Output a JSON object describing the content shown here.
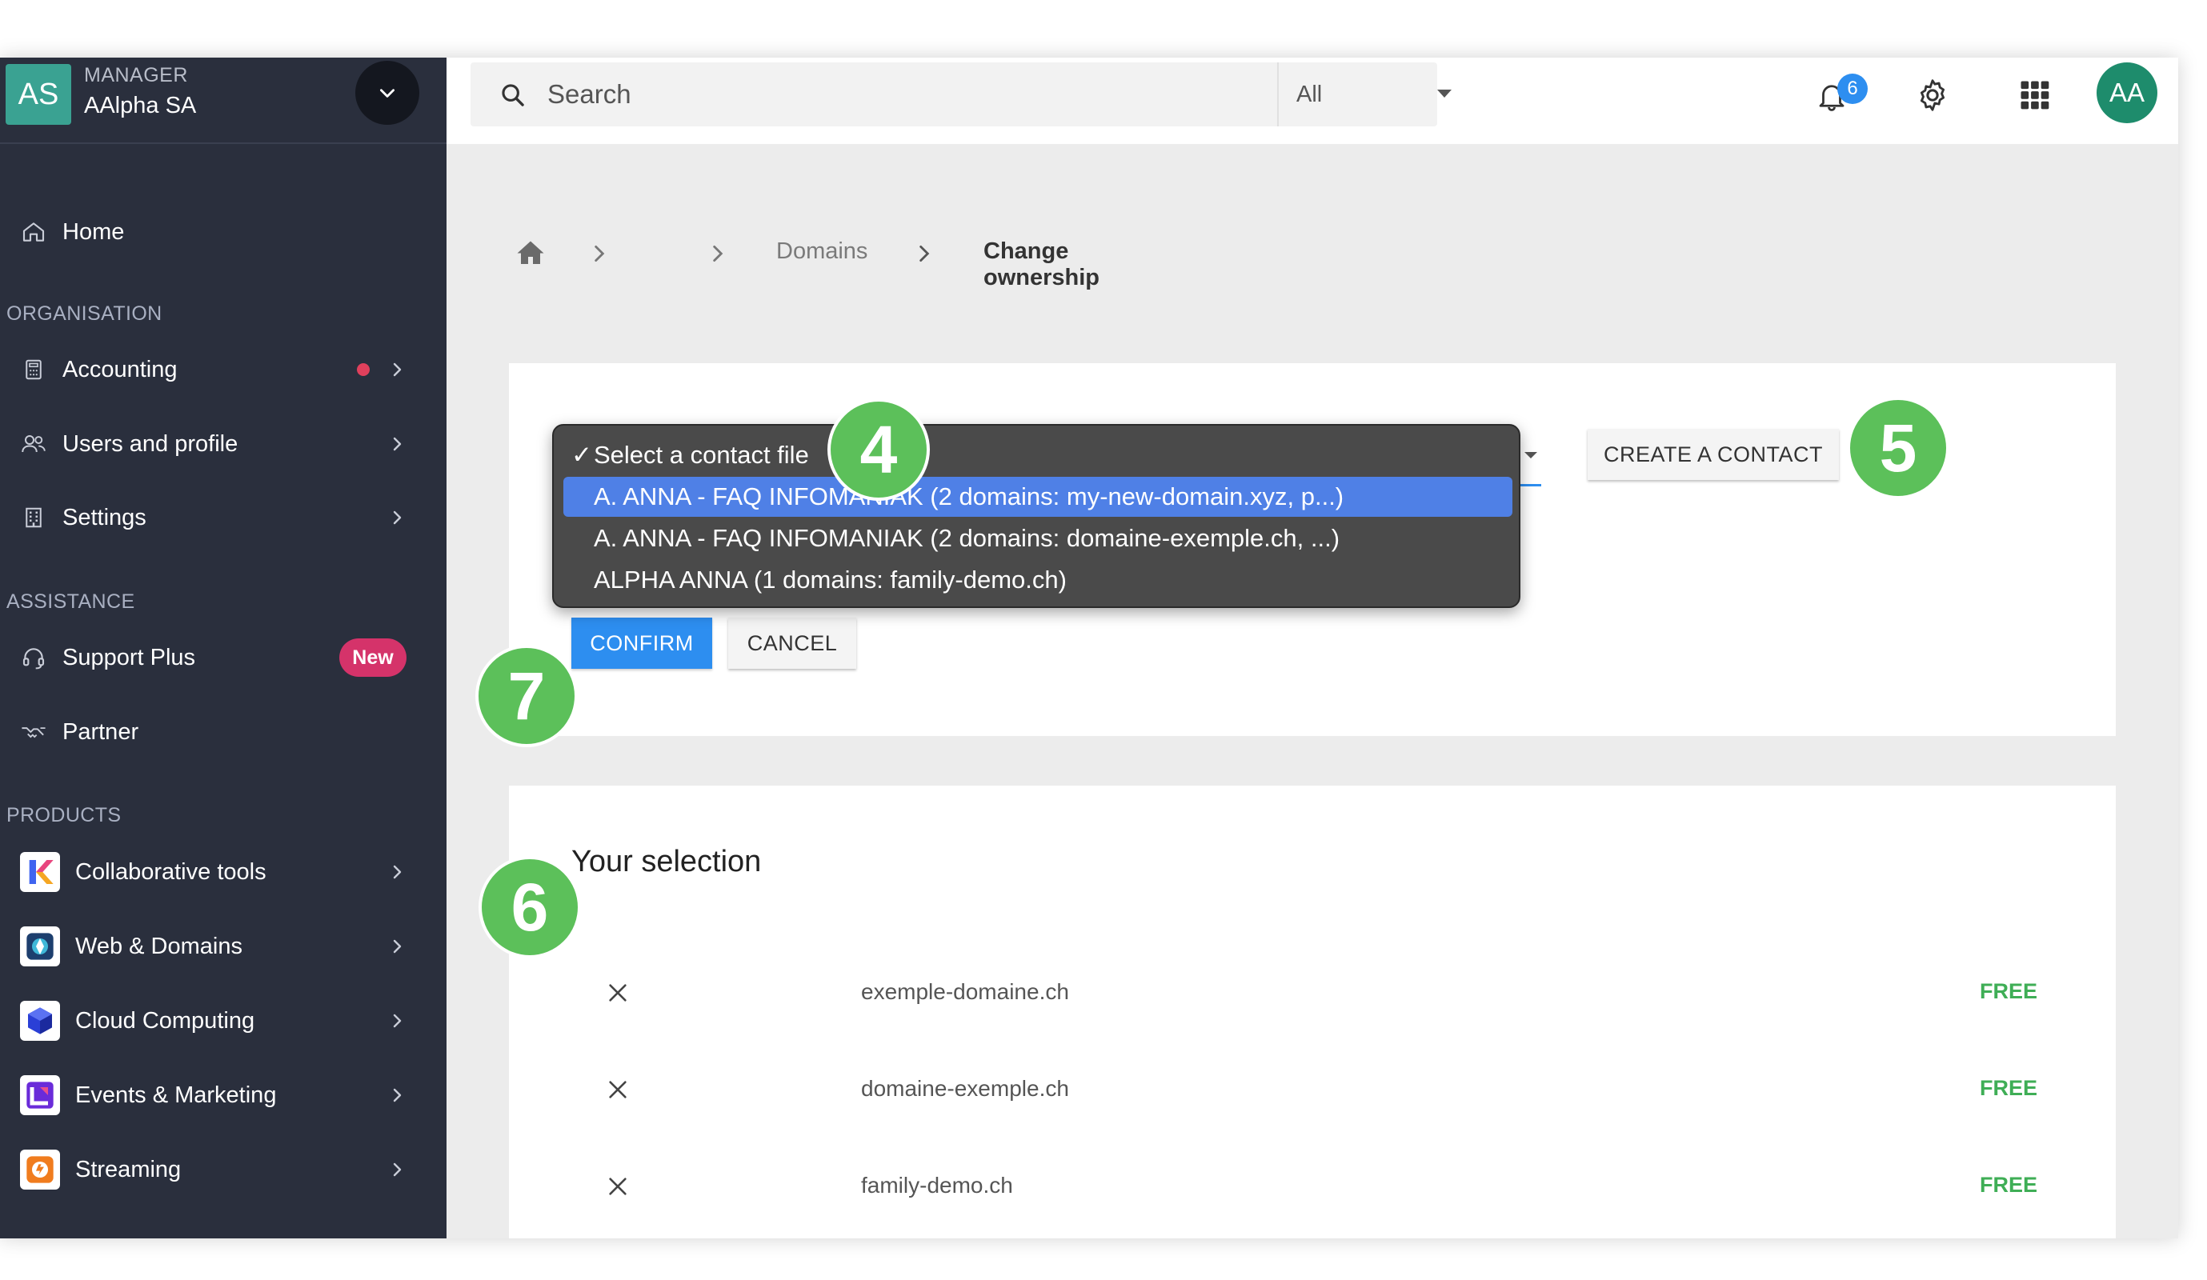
{
  "account": {
    "initials": "AS",
    "role": "MANAGER",
    "name": "AAlpha SA"
  },
  "sidebar": {
    "home": "Home",
    "sections": {
      "organisation": "ORGANISATION",
      "assistance": "ASSISTANCE",
      "products": "PRODUCTS"
    },
    "organisation_items": [
      {
        "label": "Accounting",
        "icon": "calculator-icon",
        "has_dot": true
      },
      {
        "label": "Users and profile",
        "icon": "users-icon"
      },
      {
        "label": "Settings",
        "icon": "building-icon"
      }
    ],
    "assistance_items": [
      {
        "label": "Support Plus",
        "icon": "headset-icon",
        "badge": "New"
      },
      {
        "label": "Partner",
        "icon": "handshake-icon"
      }
    ],
    "product_items": [
      {
        "label": "Collaborative tools",
        "icon": "kchat-logo-icon"
      },
      {
        "label": "Web & Domains",
        "icon": "web-domains-icon"
      },
      {
        "label": "Cloud Computing",
        "icon": "cloud-cube-icon"
      },
      {
        "label": "Events & Marketing",
        "icon": "events-icon"
      },
      {
        "label": "Streaming",
        "icon": "streaming-icon"
      }
    ]
  },
  "topbar": {
    "search_placeholder": "Search",
    "search_scope": "All",
    "notification_count": "6",
    "user_initials": "AA"
  },
  "breadcrumb": {
    "domains": "Domains",
    "current": "Change ownership"
  },
  "contact_select": {
    "options": [
      "Select a contact file",
      "A. ANNA - FAQ INFOMANIAK (2 domains: my-new-domain.xyz, p...)",
      "A. ANNA - FAQ INFOMANIAK (2 domains: domaine-exemple.ch, ...)",
      "ALPHA ANNA (1 domains: family-demo.ch)"
    ],
    "checked_index": 0,
    "highlighted_index": 1
  },
  "actions": {
    "create_contact": "CREATE A CONTACT",
    "confirm": "CONFIRM",
    "cancel": "CANCEL"
  },
  "selection": {
    "title": "Your selection",
    "rows": [
      {
        "domain": "exemple-domaine.ch",
        "price": "FREE"
      },
      {
        "domain": "domaine-exemple.ch",
        "price": "FREE"
      },
      {
        "domain": "family-demo.ch",
        "price": "FREE"
      }
    ]
  },
  "step_markers": [
    "4",
    "5",
    "6",
    "7"
  ],
  "colors": {
    "sidebar_bg": "#2a2f3d",
    "accent": "#2d8ef0",
    "marker": "#5cc05a",
    "price": "#3fae56",
    "badge_new": "#d5336a"
  }
}
